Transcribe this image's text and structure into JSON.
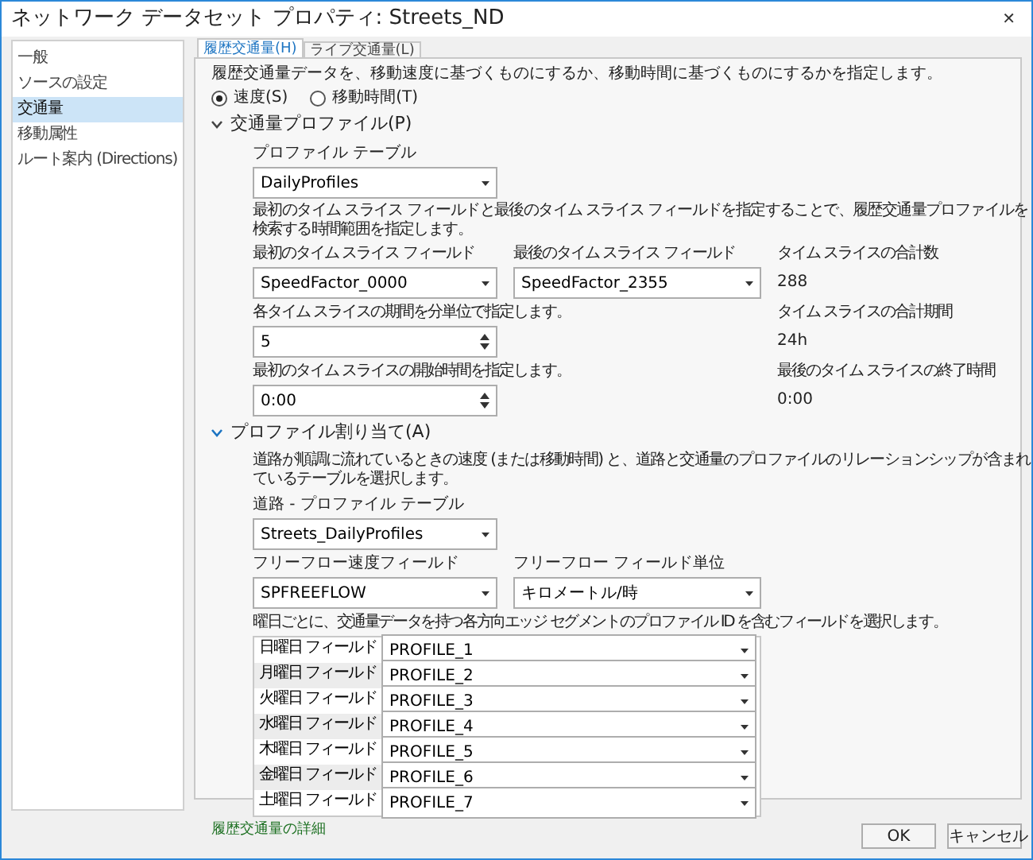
{
  "window": {
    "title": "ネットワーク データセット プロパティ: Streets_ND",
    "close": "✕"
  },
  "sidebar": {
    "items": [
      {
        "label": "一般",
        "selected": false
      },
      {
        "label": "ソースの設定",
        "selected": false
      },
      {
        "label": "交通量",
        "selected": true
      },
      {
        "label": "移動属性",
        "selected": false
      },
      {
        "label": "ルート案内 (Directions)",
        "selected": false
      }
    ]
  },
  "tabs": [
    {
      "label": "履歴交通量(H)",
      "selected": true
    },
    {
      "label": "ライブ交通量(L)",
      "selected": false
    }
  ],
  "intro": "履歴交通量データを、移動速度に基づくものにするか、移動時間に基づくものにするかを指定します。",
  "radios": [
    {
      "label": "速度(S)",
      "selected": true
    },
    {
      "label": "移動時間(T)",
      "selected": false
    }
  ],
  "profile_section": {
    "title": "交通量プロファイル(P)",
    "expanded": true,
    "table_label": "プロファイル テーブル",
    "table_value": "DailyProfiles",
    "note": "最初のタイム スライス フィールドと最後のタイム スライス フィールドを指定することで、履歴交通量プロファイルを検索する時間範囲を指定します。",
    "first_label": "最初のタイム スライス フィールド",
    "first_value": "SpeedFactor_0000",
    "last_label": "最後のタイム スライス フィールド",
    "last_value": "SpeedFactor_2355",
    "count_label": "タイム スライスの合計数",
    "count_value": "288",
    "duration_label": "各タイム スライスの期間を分単位で指定します。",
    "duration_value": "5",
    "total_label": "タイム スライスの合計期間",
    "total_value": "24h",
    "start_label": "最初のタイム スライスの開始時間を指定します。",
    "start_value": "0:00",
    "end_label": "最後のタイム スライスの終了時間",
    "end_value": "0:00"
  },
  "assign_section": {
    "title": "プロファイル割り当て(A)",
    "expanded": true,
    "note": "道路が順調に流れているときの速度 (または移動時間) と、道路と交通量のプロファイルのリレーションシップが含まれているテーブルを選択します。",
    "table_label": "道路 - プロファイル テーブル",
    "table_value": "Streets_DailyProfiles",
    "freeflow_label": "フリーフロー速度フィールド",
    "freeflow_value": "SPFREEFLOW",
    "unit_label": "フリーフロー フィールド単位",
    "unit_value": "キロメートル/時",
    "days_note": "曜日ごとに、交通量データを持つ各方向エッジ セグメントのプロファイル ID を含むフィールドを選択します。",
    "days": [
      {
        "label": "日曜日 フィールド",
        "value": "PROFILE_1"
      },
      {
        "label": "月曜日 フィールド",
        "value": "PROFILE_2"
      },
      {
        "label": "火曜日 フィールド",
        "value": "PROFILE_3"
      },
      {
        "label": "水曜日 フィールド",
        "value": "PROFILE_4"
      },
      {
        "label": "木曜日 フィールド",
        "value": "PROFILE_5"
      },
      {
        "label": "金曜日 フィールド",
        "value": "PROFILE_6"
      },
      {
        "label": "土曜日 フィールド",
        "value": "PROFILE_7"
      }
    ]
  },
  "details_link": "履歴交通量の詳細",
  "buttons": [
    "OK",
    "キャンセル"
  ]
}
